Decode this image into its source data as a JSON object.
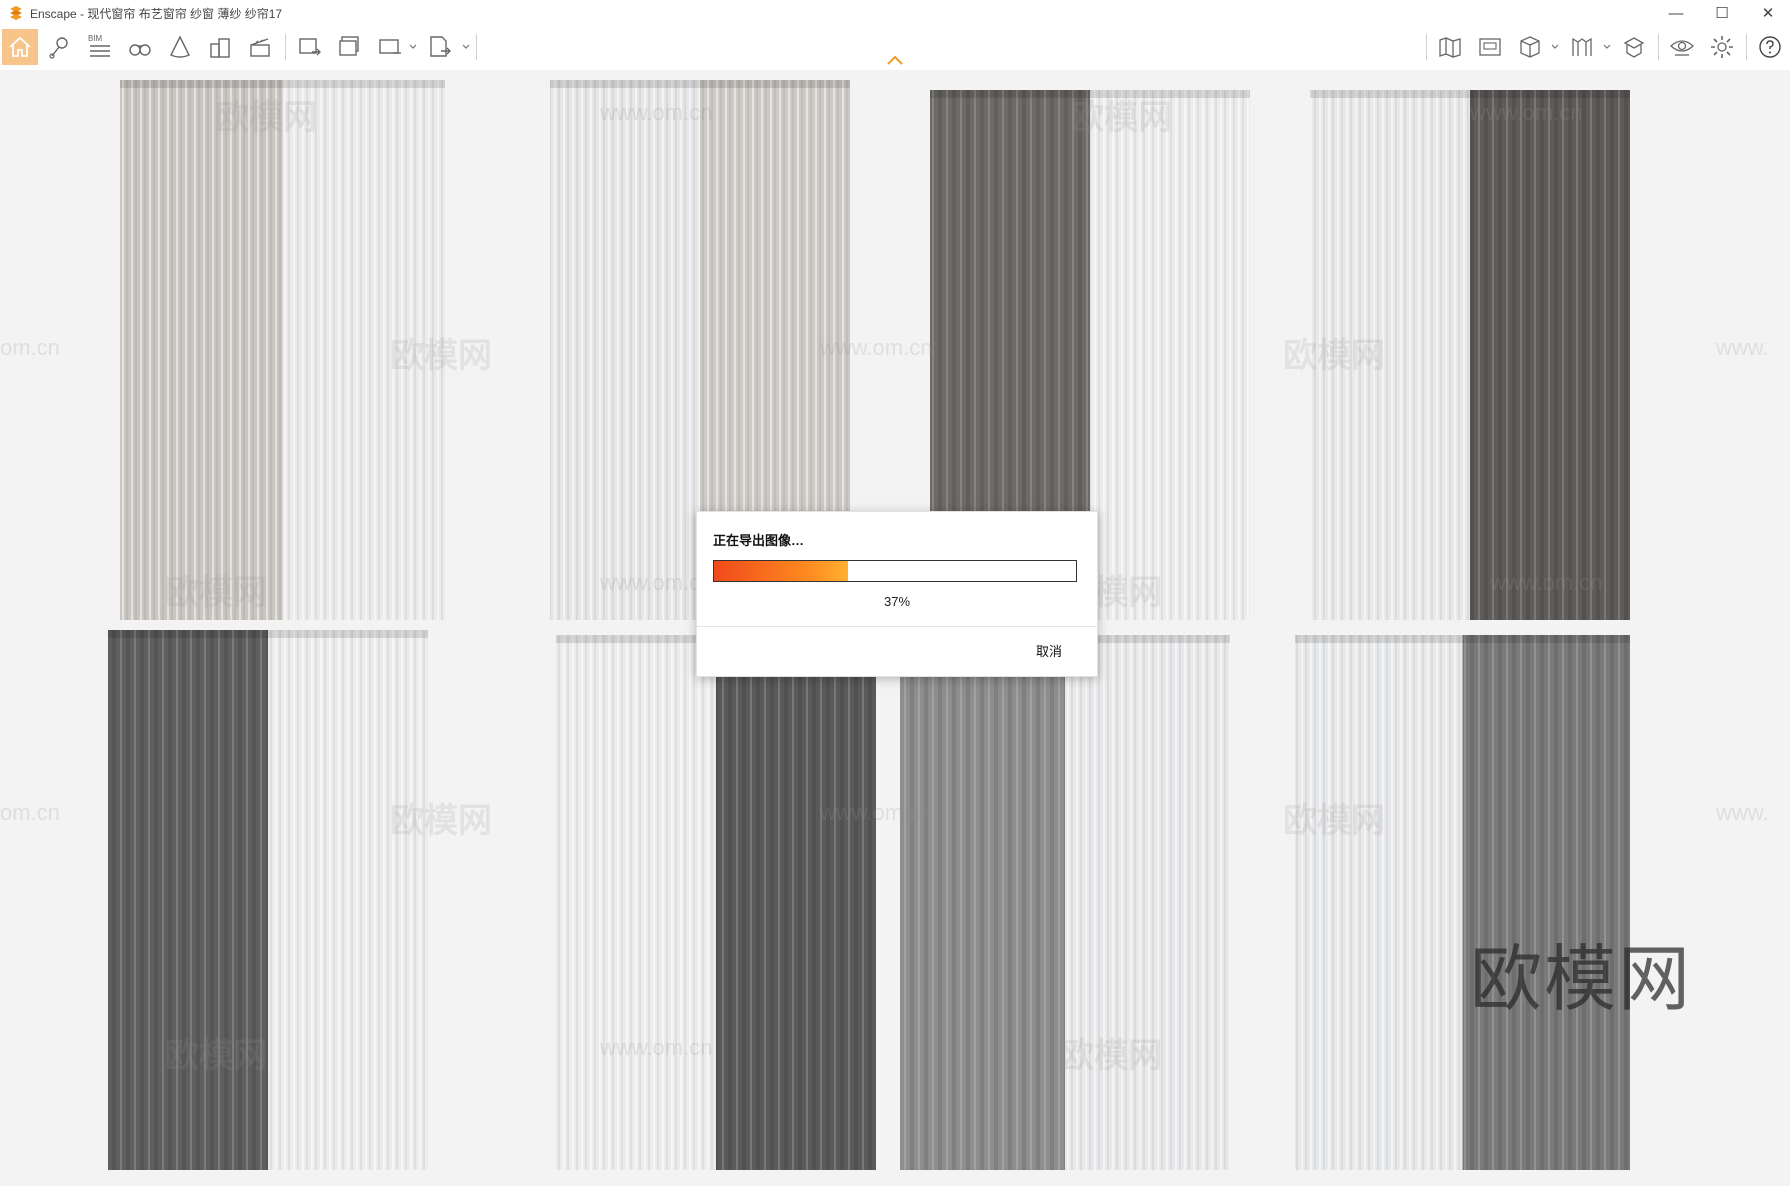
{
  "window": {
    "title": "Enscape - 现代窗帘 布艺窗帘 纱窗 薄纱 纱帘17",
    "minimize_glyph": "—",
    "maximize_glyph": "☐",
    "close_glyph": "✕"
  },
  "toolbar": {
    "bim_label": "BIM",
    "left_tools": [
      {
        "name": "home-icon",
        "active": true
      },
      {
        "name": "location-pin-icon"
      },
      {
        "name": "bim-list-icon"
      },
      {
        "name": "binoculars-icon"
      },
      {
        "name": "cone-icon"
      },
      {
        "name": "buildings-icon"
      },
      {
        "name": "clapperboard-icon"
      },
      {
        "name": "export-image-icon"
      },
      {
        "name": "batch-export-icon"
      },
      {
        "name": "panorama-360-icon"
      },
      {
        "name": "export-exe-icon"
      }
    ],
    "right_tools": [
      {
        "name": "map-icon"
      },
      {
        "name": "video-editor-icon"
      },
      {
        "name": "cube-view-icon"
      },
      {
        "name": "asset-library-icon"
      },
      {
        "name": "material-editor-icon"
      },
      {
        "name": "visibility-icon"
      },
      {
        "name": "settings-gear-icon"
      },
      {
        "name": "help-icon"
      }
    ]
  },
  "viewport": {
    "watermarks": [
      "欧模网",
      "www.om.cn",
      "om.cn",
      "www."
    ],
    "big_watermark": "欧模网",
    "curtain_panels": [
      {
        "left_shade": "#c9c5c0",
        "right_shade": "#ebebeb"
      },
      {
        "left_shade": "#e6e6e6",
        "right_shade": "#cdc9c4"
      },
      {
        "left_shade": "#6d6a67",
        "right_shade": "#ececec"
      },
      {
        "left_shade": "#e9e9ea",
        "right_shade": "#5e5b59"
      },
      {
        "left_shade": "#5f5f5f",
        "right_shade": "#ececec"
      },
      {
        "left_shade": "#ececec",
        "right_shade": "#5a5a5a"
      },
      {
        "left_shade": "#8e8e8e",
        "right_shade": "#e9e9eb"
      },
      {
        "left_shade": "#e8e9eb",
        "right_shade": "#7a7a7a"
      }
    ]
  },
  "dialog": {
    "title": "正在导出图像…",
    "progress_fraction": 0.37,
    "progress_text": "37%",
    "cancel_label": "取消"
  },
  "colors": {
    "active_tool": "#f7c48a",
    "progress_start": "#f04a1a",
    "progress_end": "#ffb030",
    "logo": "#f29a1f"
  }
}
